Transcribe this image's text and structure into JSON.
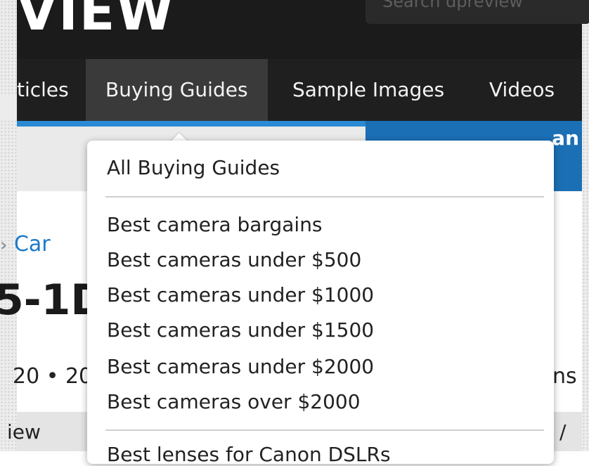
{
  "header": {
    "logo_text": "VIEW",
    "search_placeholder": "Search dpreview"
  },
  "nav": {
    "items": [
      {
        "label": "ticles"
      },
      {
        "label": "Buying Guides",
        "active": true
      },
      {
        "label": "Sample Images"
      },
      {
        "label": "Videos"
      }
    ]
  },
  "banner": {
    "right_text": "an"
  },
  "page": {
    "breadcrumb_sep": "›",
    "breadcrumb_link": "Car",
    "title_fragment": "5-1D",
    "dateline": "20 • 20",
    "right_snippet": "ns",
    "tab_left": "iew",
    "tab_right": "/"
  },
  "dropdown": {
    "header_item": "All Buying Guides",
    "items": [
      "Best camera bargains",
      "Best cameras under $500",
      "Best cameras under $1000",
      "Best cameras under $1500",
      "Best cameras under $2000",
      "Best cameras over $2000"
    ],
    "cutoff_item": "Best lenses for Canon DSLRs"
  },
  "colors": {
    "nav_bg": "#1f1f1f",
    "nav_active_bg": "#3a3a3a",
    "accent_blue": "#1b6fb5",
    "link_blue": "#1b7ac9"
  }
}
